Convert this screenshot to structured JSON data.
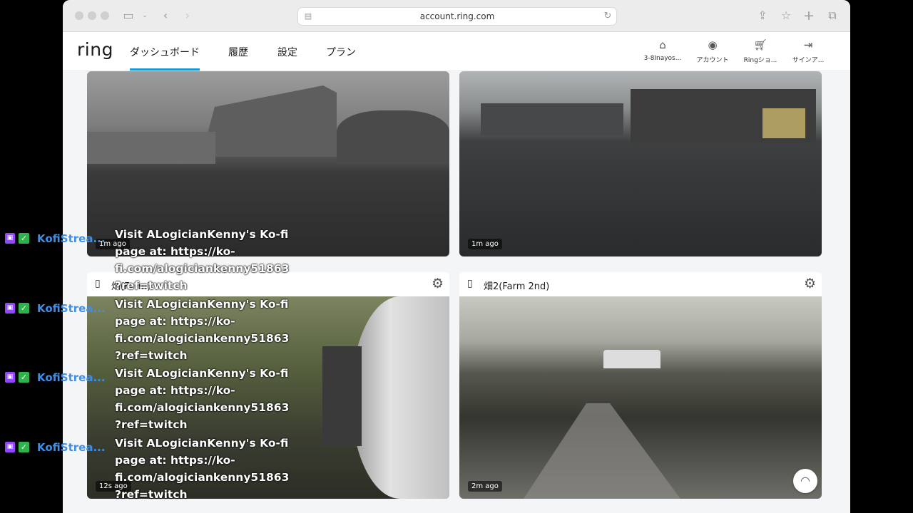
{
  "browser": {
    "url": "account.ring.com"
  },
  "nav": {
    "logo": "ring",
    "tabs": [
      {
        "label": "ダッシュボード",
        "active": true
      },
      {
        "label": "履歴"
      },
      {
        "label": "設定"
      },
      {
        "label": "プラン"
      }
    ],
    "actions": [
      {
        "icon": "home-icon",
        "label": "3-8Inayos..."
      },
      {
        "icon": "account-icon",
        "label": "アカウント"
      },
      {
        "icon": "cart-icon",
        "label": "Ringショ..."
      },
      {
        "icon": "sign-out-icon",
        "label": "サインア..."
      }
    ]
  },
  "cameras": [
    {
      "name": "",
      "time": "1m ago"
    },
    {
      "name": "",
      "time": "1m ago"
    },
    {
      "name": "畑(Farm)",
      "time": "12s ago"
    },
    {
      "name": "畑2(Farm 2nd)",
      "time": "2m ago"
    }
  ],
  "overlay": {
    "username": "KofiStrea...",
    "message": "Visit ALogicianKenny's Ko-fi\npage at: https://ko-\nfi.com/alogiciankenny51863\n?ref=twitch"
  },
  "colors": {
    "accent": "#1998d5",
    "twitch": "#9146ff",
    "check": "#2fb24c",
    "username": "#3f8fe8"
  }
}
